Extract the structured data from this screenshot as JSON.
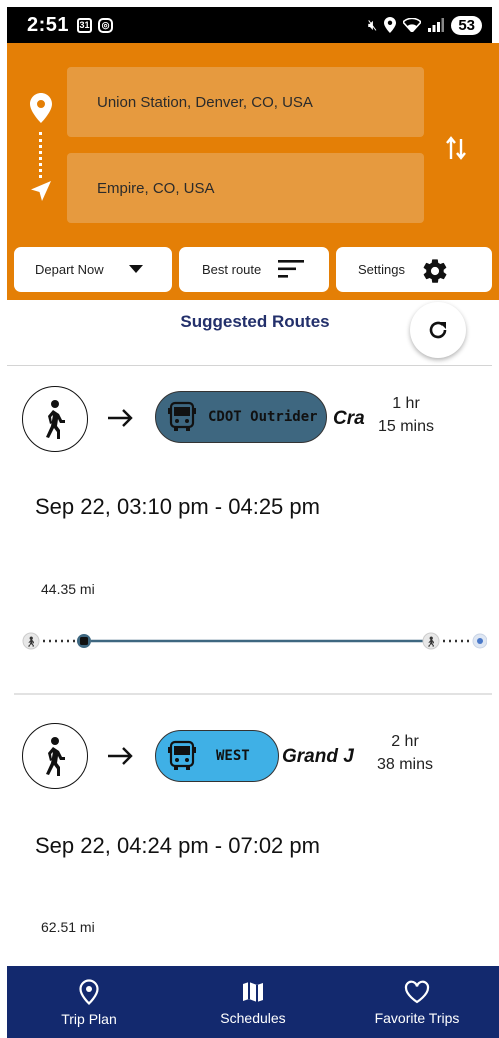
{
  "status_bar": {
    "time": "2:51",
    "notif_calendar": "31",
    "battery": "53"
  },
  "trip": {
    "from": "Union Station, Denver, CO, USA",
    "to": "Empire, CO, USA"
  },
  "options": {
    "depart_label": "Depart Now",
    "sort_label": "Best route",
    "settings_label": "Settings"
  },
  "section_title": "Suggested Routes",
  "routes": [
    {
      "bus_label": "CDOT Outrider",
      "route_name": "Cra",
      "duration_hr": "1 hr",
      "duration_min": "15 mins",
      "time_range": "Sep 22, 03:10 pm - 04:25 pm",
      "distance": "44.35 mi",
      "pill_color": "#3e6780"
    },
    {
      "bus_label": "WEST",
      "route_name": "Grand J",
      "duration_hr": "2 hr",
      "duration_min": "38 mins",
      "time_range": "Sep 22, 04:24 pm - 07:02 pm",
      "distance": "62.51 mi",
      "pill_color": "#3fb0e6"
    }
  ],
  "bottom_nav": [
    {
      "label": "Trip Plan",
      "icon": "location-pin-icon"
    },
    {
      "label": "Schedules",
      "icon": "map-icon"
    },
    {
      "label": "Favorite Trips",
      "icon": "heart-icon"
    }
  ],
  "colors": {
    "header": "#e47f06",
    "nav": "#13296e",
    "title": "#23306b"
  }
}
